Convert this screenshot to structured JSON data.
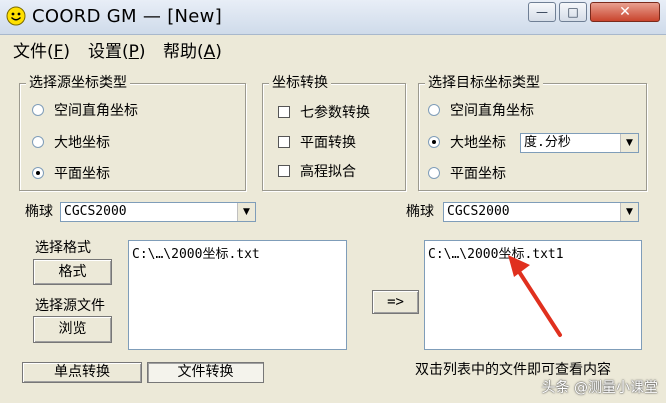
{
  "window": {
    "title": "COORD GM — [New]"
  },
  "menu": [
    {
      "label": "文件(",
      "key": "F",
      "suffix": ")"
    },
    {
      "label": "设置(",
      "key": "P",
      "suffix": ")"
    },
    {
      "label": "帮助(",
      "key": "A",
      "suffix": ")"
    }
  ],
  "source_type": {
    "title": "选择源坐标类型",
    "options": [
      "空间直角坐标",
      "大地坐标",
      "平面坐标"
    ],
    "selected": "平面坐标"
  },
  "conversion": {
    "title": "坐标转换",
    "options": [
      "七参数转换",
      "平面转换",
      "高程拟合"
    ]
  },
  "target_type": {
    "title": "选择目标坐标类型",
    "options": [
      "空间直角坐标",
      "大地坐标",
      "平面坐标"
    ],
    "selected": "大地坐标",
    "format_value": "度.分秒"
  },
  "ellipsoid_left": {
    "label": "椭球",
    "value": "CGCS2000"
  },
  "ellipsoid_right": {
    "label": "椭球",
    "value": "CGCS2000"
  },
  "format_section": {
    "label": "选择格式",
    "button": "格式"
  },
  "source_file": {
    "label": "选择源文件",
    "button": "浏览"
  },
  "source_list": [
    "C:\\…\\2000坐标.txt"
  ],
  "convert_button": "=>",
  "target_list": [
    "C:\\…\\2000坐标.txt1"
  ],
  "bottom": {
    "single_button": "单点转换",
    "file_button": "文件转换",
    "hint": "双击列表中的文件即可查看内容"
  },
  "watermark": "头条 @测量小课堂",
  "colors": {
    "annotation_arrow": "#e0301e"
  }
}
